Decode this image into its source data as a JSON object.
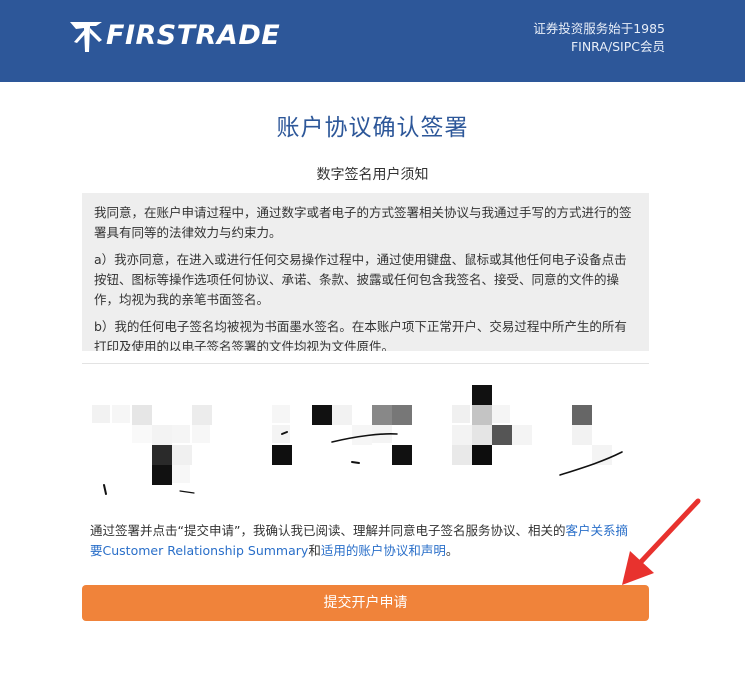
{
  "header": {
    "brand": "FIRSTRADE",
    "tagline_line1": "证券投资服务始于1985",
    "tagline_line2": "FINRA/SIPC会员"
  },
  "page": {
    "title": "账户协议确认签署",
    "subtitle": "数字签名用户须知"
  },
  "notice": {
    "paragraphs": [
      "我同意，在账户申请过程中，通过数字或者电子的方式签署相关协议与我通过手写的方式进行的签署具有同等的法律效力与约束力。",
      "a）我亦同意，在进入或进行任何交易操作过程中，通过使用键盘、鼠标或其他任何电子设备点击按钮、图标等操作选项任何协议、承诺、条款、披露或任何包含我签名、接受、同意的文件的操作，均视为我的亲笔书面签名。",
      "b）我的任何电子签名均被视为书面墨水签名。在本账户项下正常开户、交易过程中所产生的所有打印及使用的以电子签名签署的文件均视为文件原件。"
    ]
  },
  "consent": {
    "text_before": "通过签署并点击“提交申请”，我确认我已阅读、理解并同意电子签名服务协议、相关的",
    "link1": "客户关系摘要Customer Relationship Summary",
    "text_middle": "和",
    "link2": "适用的账户协议和声明",
    "text_after": "。"
  },
  "submit": {
    "label": "提交开户申请"
  },
  "colors": {
    "header_bg": "#2d5799",
    "title": "#2d5799",
    "submit_bg": "#f0833a",
    "link": "#2a6fc9",
    "arrow": "#e8322e"
  }
}
